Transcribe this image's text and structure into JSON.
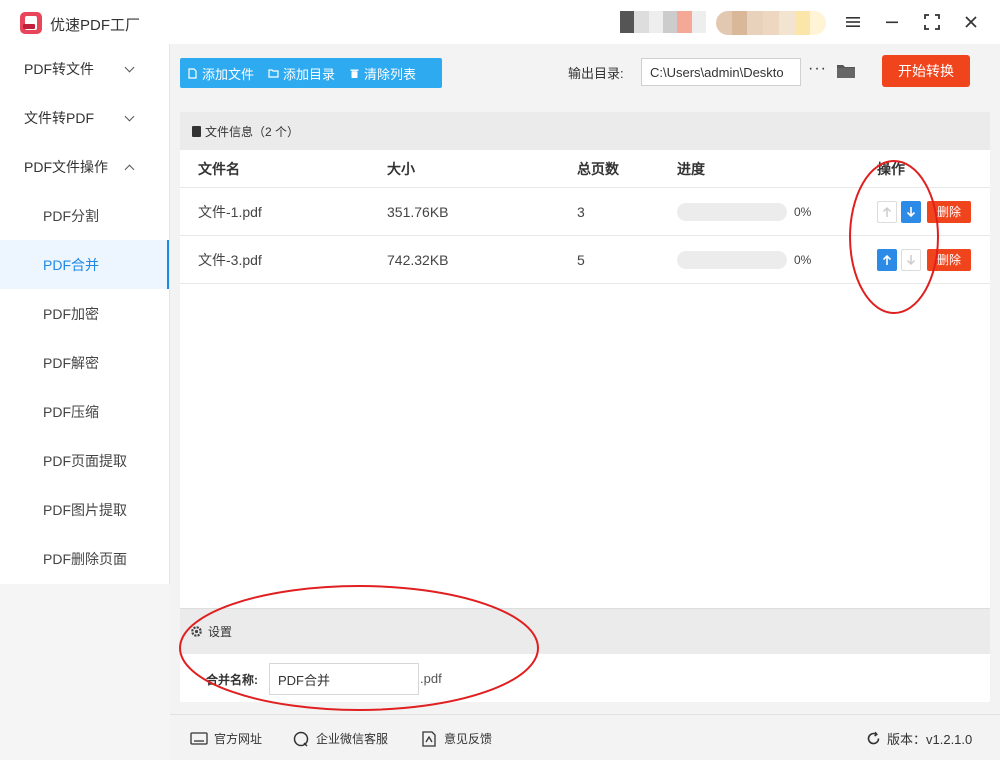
{
  "app": {
    "title": "优速PDF工厂"
  },
  "sidebar": {
    "groups": [
      {
        "label": "PDF转文件"
      },
      {
        "label": "文件转PDF"
      },
      {
        "label": "PDF文件操作"
      }
    ],
    "items": [
      {
        "label": "PDF分割"
      },
      {
        "label": "PDF合并"
      },
      {
        "label": "PDF加密"
      },
      {
        "label": "PDF解密"
      },
      {
        "label": "PDF压缩"
      },
      {
        "label": "PDF页面提取"
      },
      {
        "label": "PDF图片提取"
      },
      {
        "label": "PDF删除页面"
      }
    ]
  },
  "toolbar": {
    "add_file": "添加文件",
    "add_dir": "添加目录",
    "clear_list": "清除列表",
    "output_label": "输出目录:",
    "output_path": "C:\\Users\\admin\\Deskto",
    "more": "···",
    "start": "开始转换"
  },
  "file_panel": {
    "title": "文件信息（2 个）",
    "columns": {
      "name": "文件名",
      "size": "大小",
      "pages": "总页数",
      "progress": "进度",
      "ops": "操作"
    },
    "rows": [
      {
        "name": "文件-1.pdf",
        "size": "351.76KB",
        "pages": "3",
        "progress": "0%",
        "delete": "删除"
      },
      {
        "name": "文件-3.pdf",
        "size": "742.32KB",
        "pages": "5",
        "progress": "0%",
        "delete": "删除"
      }
    ]
  },
  "settings": {
    "title": "设置",
    "merge_label": "合并名称:",
    "merge_value": "PDF合并",
    "merge_ext": ".pdf"
  },
  "footer": {
    "website": "官方网址",
    "wechat": "企业微信客服",
    "feedback": "意见反馈",
    "version": "版本：v1.2.1.0"
  },
  "colors": {
    "accent_blue": "#2b8be6",
    "toolbar_blue": "#2eaaf0",
    "start_red": "#f0441c",
    "annotation_red": "#e02020"
  }
}
